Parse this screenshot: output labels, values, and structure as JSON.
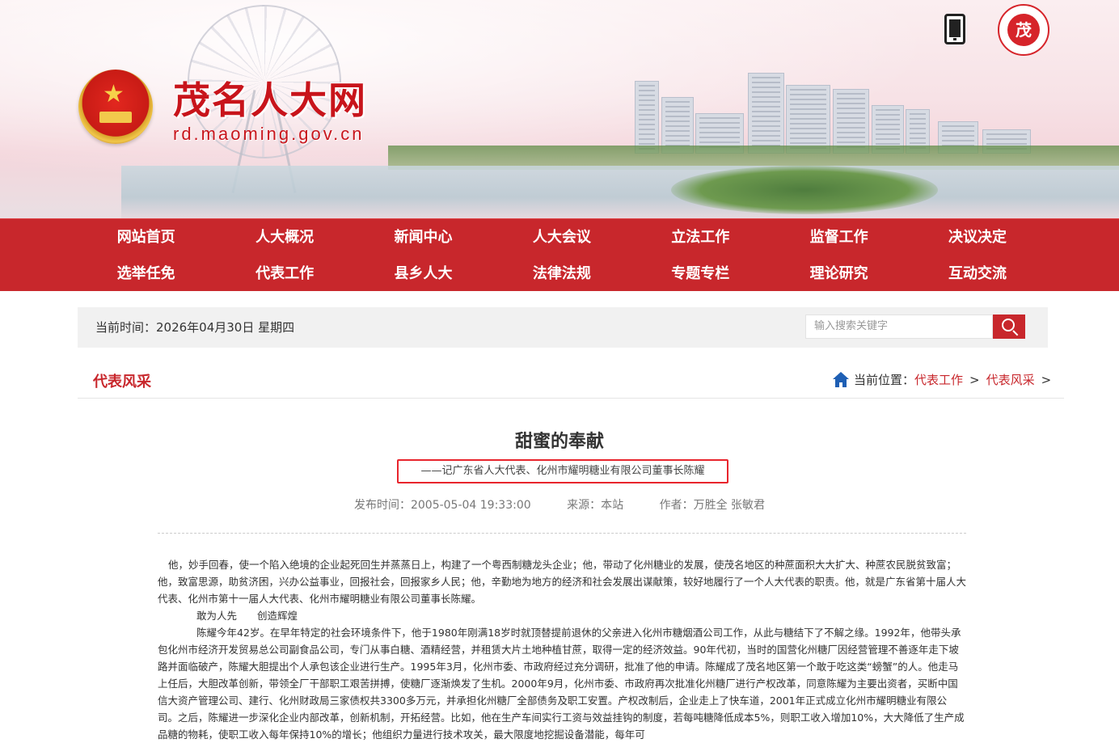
{
  "header": {
    "site_title": "茂名人大网",
    "site_url": "rd.maoming.gov.cn",
    "logo_text": "茂"
  },
  "nav": {
    "row1": [
      "网站首页",
      "人大概况",
      "新闻中心",
      "人大会议",
      "立法工作",
      "监督工作",
      "决议决定"
    ],
    "row2": [
      "选举任免",
      "代表工作",
      "县乡人大",
      "法律法规",
      "专题专栏",
      "理论研究",
      "互动交流"
    ]
  },
  "timebar": {
    "current_time": "当前时间：2026年04月30日 星期四",
    "search_placeholder": "输入搜索关键字"
  },
  "section": {
    "title": "代表风采",
    "breadcrumb_label": "当前位置：",
    "crumb1": "代表工作",
    "crumb2": "代表风采",
    "sep": ">"
  },
  "article": {
    "title": "甜蜜的奉献",
    "subtitle": "——记广东省人大代表、化州市耀明糖业有限公司董事长陈耀",
    "published": "发布时间：2005-05-04  19:33:00",
    "source": "来源：本站",
    "author": "作者：万胜全 张敏君",
    "paragraphs": [
      "他，妙手回春，使一个陷入绝境的企业起死回生并蒸蒸日上，构建了一个粤西制糖龙头企业；他，带动了化州糖业的发展，使茂名地区的种蔗面积大大扩大、种蔗农民脱贫致富；他，致富思源，助贫济困，兴办公益事业，回报社会，回报家乡人民；他，辛勤地为地方的经济和社会发展出谋献策，较好地履行了一个人大代表的职责。他，就是广东省第十届人大代表、化州市第十一届人大代表、化州市耀明糖业有限公司董事长陈耀。",
      "敢为人先　　创造辉煌",
      "陈耀今年42岁。在早年特定的社会环境条件下，他于1980年刚满18岁时就顶替提前退休的父亲进入化州市糖烟酒公司工作，从此与糖结下了不解之缘。1992年，他带头承包化州市经济开发贸易总公司副食品公司，专门从事白糖、酒精经营，并租赁大片土地种植甘蔗，取得一定的经济效益。90年代初，当时的国营化州糖厂因经营管理不善逐年走下坡路并面临破产，陈耀大胆提出个人承包该企业进行生产。1995年3月，化州市委、市政府经过充分调研，批准了他的申请。陈耀成了茂名地区第一个敢于吃这类“螃蟹”的人。他走马上任后，大胆改革创新，带领全厂干部职工艰苦拼搏，使糖厂逐渐焕发了生机。2000年9月，化州市委、市政府再次批准化州糖厂进行产权改革，同意陈耀为主要出资者，买断中国信大资产管理公司、建行、化州财政局三家债权共3300多万元，并承担化州糖厂全部债务及职工安置。产权改制后，企业走上了快车道，2001年正式成立化州市耀明糖业有限公司。之后，陈耀进一步深化企业内部改革，创新机制，开拓经营。比如，他在生产车间实行工资与效益挂钩的制度，若每吨糖降低成本5%，则职工收入增加10%，大大降低了生产成品糖的物耗，使职工收入每年保持10%的增长；他组织力量进行技术攻关，最大限度地挖掘设备潜能，每年可"
    ]
  }
}
